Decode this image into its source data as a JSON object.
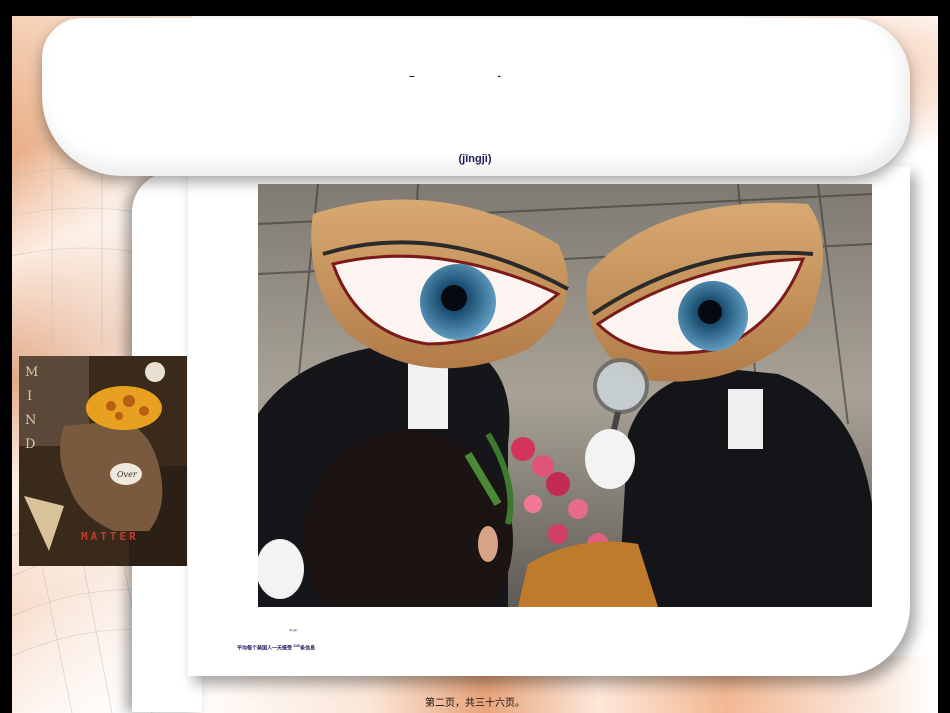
{
  "slide": {
    "title": "– -",
    "pinyin": "(jīngjì)",
    "caption_small": "(jīngjì)",
    "caption_line": "平均每个美国人一天接受",
    "caption_number": "340",
    "caption_tail": "条信息",
    "footer": "第二页，共三十六页。"
  },
  "art": {
    "mind_letters": [
      "M",
      "I",
      "N",
      "D"
    ],
    "matter_word": "MATTER",
    "over_word": "Over"
  },
  "colors": {
    "title_color": "#1a1a5a",
    "background": "#000000",
    "warm_accent": "#e7a578"
  }
}
